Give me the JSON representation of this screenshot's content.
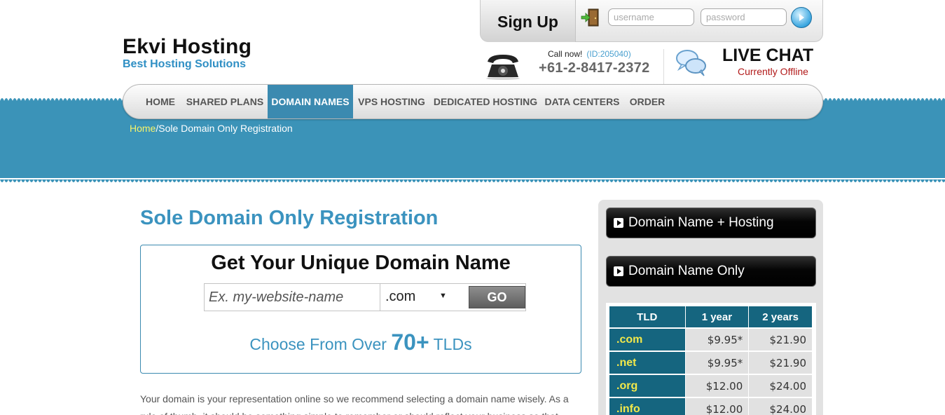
{
  "header": {
    "logo_title": "Ekvi Hosting",
    "logo_subtitle": "Best Hosting Solutions",
    "signup_label": "Sign Up",
    "username_placeholder": "username",
    "password_placeholder": "password",
    "call_now": "Call now!",
    "call_id": "(ID:205040)",
    "phone_number": "+61-2-8417-2372",
    "live_chat_title": "LIVE CHAT",
    "live_chat_status": "Currently Offline"
  },
  "nav": {
    "items": [
      {
        "label": "HOME"
      },
      {
        "label": "SHARED PLANS"
      },
      {
        "label": "DOMAIN NAMES"
      },
      {
        "label": "VPS HOSTING"
      },
      {
        "label": "DEDICATED HOSTING"
      },
      {
        "label": "DATA CENTERS"
      },
      {
        "label": "ORDER"
      }
    ],
    "active_index": 2
  },
  "breadcrumb": {
    "home": "Home",
    "separator": "/",
    "current": "Sole Domain Only Registration"
  },
  "main": {
    "page_title": "Sole Domain Only Registration",
    "search_heading": "Get Your Unique Domain Name",
    "search_placeholder": "Ex. my-website-name",
    "tld_selected": ".com",
    "go_label": "GO",
    "choose_prefix": "Choose From Over",
    "choose_number": "70+",
    "choose_suffix": "TLDs",
    "intro_text": "Your domain is your representation online so we recommend selecting a domain name wisely. As a rule of thumb, it should be something simple to remember or should reflect your business so that"
  },
  "sidebar": {
    "buttons": [
      {
        "label": "Domain Name + Hosting"
      },
      {
        "label": "Domain Name Only"
      }
    ],
    "pricing": {
      "headers": [
        "TLD",
        "1 year",
        "2 years"
      ],
      "rows": [
        {
          "tld": ".com",
          "one_year": "$9.95*",
          "two_years": "$21.90"
        },
        {
          "tld": ".net",
          "one_year": "$9.95*",
          "two_years": "$21.90"
        },
        {
          "tld": ".org",
          "one_year": "$12.00",
          "two_years": "$24.00"
        },
        {
          "tld": ".info",
          "one_year": "$12.00",
          "two_years": "$24.00"
        }
      ]
    }
  },
  "colors": {
    "brand_blue": "#3b8ab0",
    "table_teal": "#15657f",
    "tld_yellow": "#f2e84a",
    "offline_red": "#b21a1a"
  }
}
